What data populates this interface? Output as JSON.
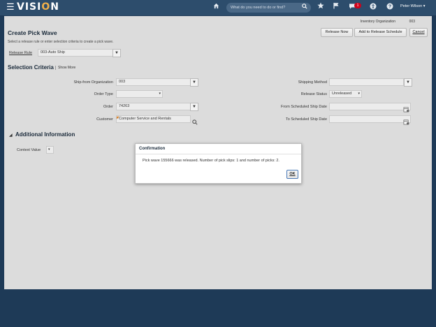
{
  "app": {
    "logo_prefix": "VISI",
    "logo_o": "O",
    "logo_suffix": "N",
    "search_placeholder": "What do you need to do or find?",
    "notification_count": "1",
    "user_name": "Peter Wilson"
  },
  "icons": {
    "menu": "hamburger-icon",
    "home": "home-icon",
    "search": "search-icon",
    "favorites": "star-icon",
    "flag": "flag-icon",
    "notifications": "chat-bubble-icon",
    "accessibility": "accessibility-icon",
    "help": "help-icon"
  },
  "page": {
    "title": "Create Pick Wave",
    "subtitle": "Select a release rule or enter selection criteria to create a pick wave.",
    "org_label": "Inventory Organization",
    "org_value": "003",
    "buttons": {
      "release_now": "Release Now",
      "add_to_schedule": "Add to Release Schedule",
      "cancel": "Cancel"
    },
    "release_rule": {
      "label": "Release Rule",
      "value": "003-Auto Ship"
    }
  },
  "selection_criteria": {
    "title": "Selection Criteria",
    "show_more": "Show More",
    "ship_from_org": {
      "label": "Ship-from Organization",
      "value": "003"
    },
    "order_type": {
      "label": "Order Type",
      "value": ""
    },
    "order": {
      "label": "Order",
      "value": "74263"
    },
    "customer": {
      "label": "Customer",
      "value": "Computer Service and Rentals"
    },
    "shipping_method": {
      "label": "Shipping Method",
      "value": ""
    },
    "release_status": {
      "label": "Release Status",
      "value": "Unreleased"
    },
    "from_ship_date": {
      "label": "From Scheduled Ship Date",
      "value": ""
    },
    "to_ship_date": {
      "label": "To Scheduled Ship Date",
      "value": ""
    }
  },
  "additional_info": {
    "title": "Additional Information",
    "context_value": {
      "label": "Context Value",
      "value": ""
    }
  },
  "dialog": {
    "title": "Confirmation",
    "message": "Pick wave 155666 was released. Number of pick slips: 1 and number of picks: 2.",
    "ok": "OK"
  },
  "colors": {
    "background": "#1e3a57",
    "topbar": "#2d4d6c",
    "panel": "#dcdcdc",
    "logo_accent": "#f0b04a",
    "badge": "#d0021b"
  }
}
